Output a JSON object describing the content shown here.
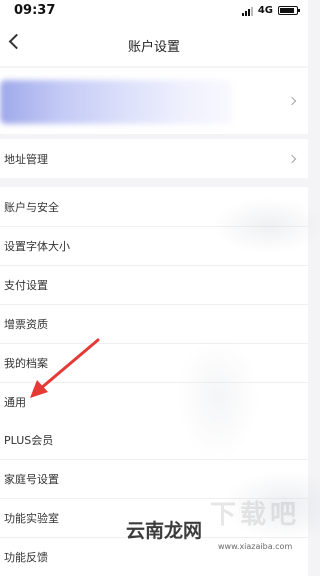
{
  "status_bar": {
    "time": "09:37",
    "network": "4G"
  },
  "nav": {
    "title": "账户设置",
    "back_icon": "chevron-left-icon"
  },
  "profile": {
    "chevron_icon": "chevron-right-icon"
  },
  "address_row": {
    "label": "地址管理"
  },
  "section_1": {
    "items": [
      {
        "label": "账户与安全"
      },
      {
        "label": "设置字体大小"
      },
      {
        "label": "支付设置"
      },
      {
        "label": "增票资质"
      },
      {
        "label": "我的档案"
      },
      {
        "label": "通用"
      }
    ]
  },
  "section_2": {
    "items": [
      {
        "label": "PLUS会员"
      },
      {
        "label": "家庭号设置"
      },
      {
        "label": "功能实验室"
      },
      {
        "label": "功能反馈"
      }
    ]
  },
  "annotation": {
    "arrow_color": "#e53935"
  },
  "watermark": {
    "big_text": "下载吧",
    "logo_text": "云南龙网",
    "url": "www.xiazaiba.com"
  }
}
